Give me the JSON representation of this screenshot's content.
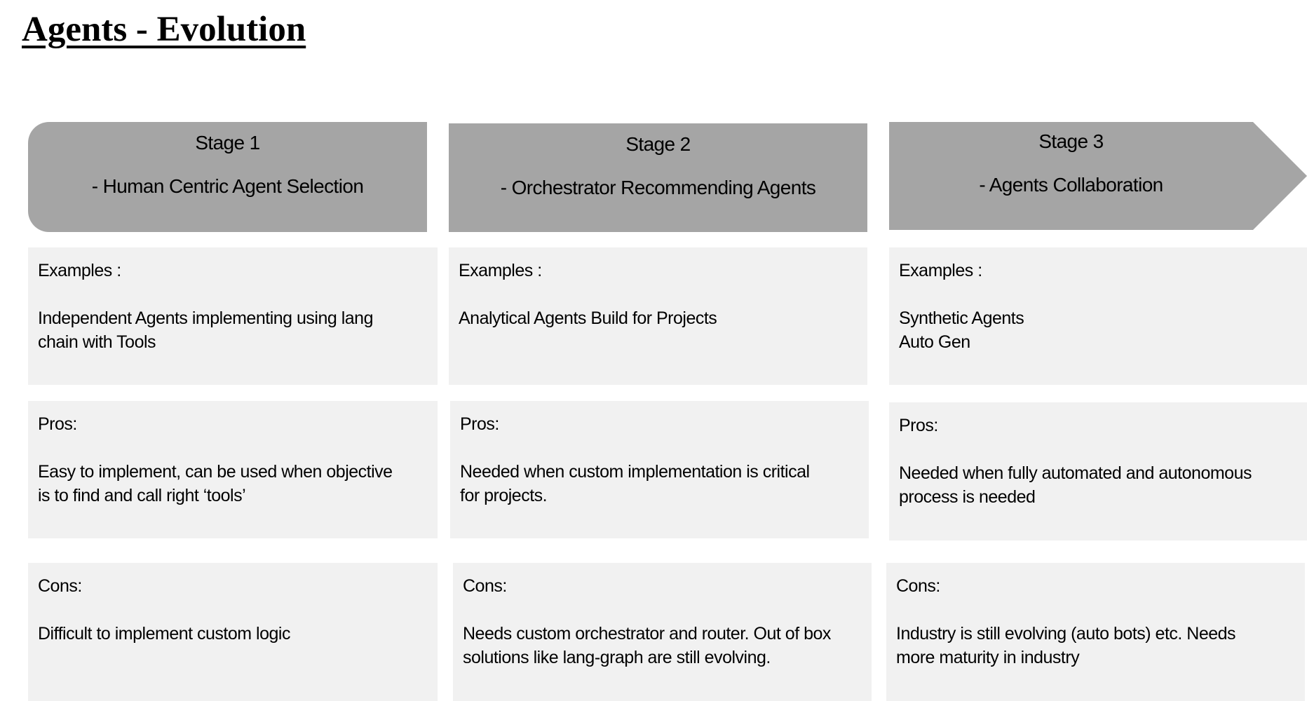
{
  "page": {
    "title": "Agents - Evolution"
  },
  "stages": [
    {
      "name": "Stage 1",
      "subtitle": "- Human Centric Agent Selection",
      "examples": {
        "label": "Examples :",
        "text": "Independent Agents implementing using lang\nchain with Tools"
      },
      "pros": {
        "label": "Pros:",
        "text": "Easy to implement, can be used when objective\nis to find and call right ‘tools’"
      },
      "cons": {
        "label": "Cons:",
        "text": "Difficult to implement custom logic"
      }
    },
    {
      "name": "Stage 2",
      "subtitle": "- Orchestrator Recommending Agents",
      "examples": {
        "label": "Examples :",
        "text": "Analytical Agents Build for Projects"
      },
      "pros": {
        "label": "Pros:",
        "text": "Needed when custom implementation is critical\nfor projects."
      },
      "cons": {
        "label": "Cons:",
        "text": "Needs custom orchestrator and router. Out of box\nsolutions like lang-graph are still evolving."
      }
    },
    {
      "name": "Stage 3",
      "subtitle": "- Agents Collaboration",
      "examples": {
        "label": "Examples :",
        "text": "Synthetic Agents\nAuto Gen"
      },
      "pros": {
        "label": "Pros:",
        "text": "Needed when fully automated and autonomous\nprocess is needed"
      },
      "cons": {
        "label": "Cons:",
        "text": "Industry is still evolving (auto bots) etc. Needs\nmore maturity in industry"
      }
    }
  ],
  "colors": {
    "header_fill": "#a5a5a5",
    "card_fill": "#f1f1f1",
    "text": "#000000"
  }
}
